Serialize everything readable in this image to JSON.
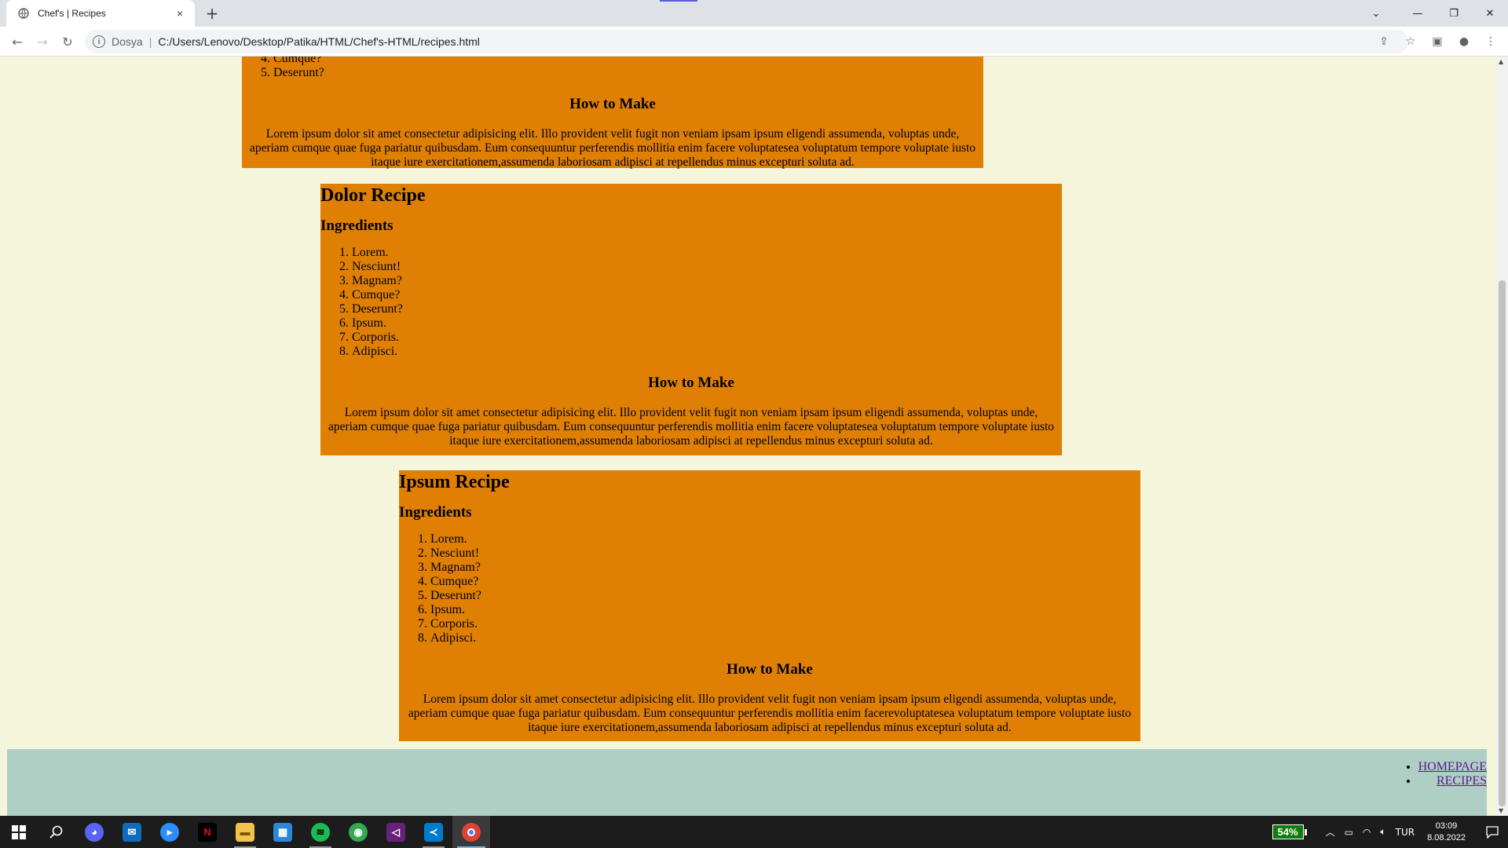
{
  "browser": {
    "tab_title": "Chef's | Recipes",
    "tab_close": "×",
    "new_tab": "+",
    "address_scheme": "Dosya",
    "address_url": "C:/Users/Lenovo/Desktop/Patika/HTML/Chef's-HTML/recipes.html"
  },
  "recipes": [
    {
      "title": "",
      "partial_items": [
        "Cumque?",
        "Deserunt?"
      ],
      "how_heading": "How to Make",
      "description": "Lorem ipsum dolor sit amet consectetur adipisicing elit. Illo provident velit fugit non veniam ipsam ipsum eligendi assumenda, voluptas unde, aperiam cumque quae fuga pariatur quibusdam. Eum consequuntur perferendis mollitia enim facere voluptatesea voluptatum tempore voluptate iusto itaque iure exercitationem,assumenda laboriosam adipisci at repellendus minus excepturi soluta ad."
    },
    {
      "title": "Dolor Recipe",
      "ingredients_heading": "Ingredients",
      "items": [
        "Lorem.",
        "Nesciunt!",
        "Magnam?",
        "Cumque?",
        "Deserunt?",
        "Ipsum.",
        "Corporis.",
        "Adipisci."
      ],
      "how_heading": "How to Make",
      "description": "Lorem ipsum dolor sit amet consectetur adipisicing elit. Illo provident velit fugit non veniam ipsam ipsum eligendi assumenda, voluptas unde, aperiam cumque quae fuga pariatur quibusdam. Eum consequuntur perferendis mollitia enim facere voluptatesea voluptatum tempore voluptate iusto itaque iure exercitationem,assumenda laboriosam adipisci at repellendus minus excepturi soluta ad."
    },
    {
      "title": "Ipsum Recipe",
      "ingredients_heading": "Ingredients",
      "items": [
        "Lorem.",
        "Nesciunt!",
        "Magnam?",
        "Cumque?",
        "Deserunt?",
        "Ipsum.",
        "Corporis.",
        "Adipisci."
      ],
      "how_heading": "How to Make",
      "description": "Lorem ipsum dolor sit amet consectetur adipisicing elit. Illo provident velit fugit non veniam ipsam ipsum eligendi assumenda, voluptas unde, aperiam cumque quae fuga pariatur quibusdam. Eum consequuntur perferendis mollitia enim facerevoluptatesea voluptatum tempore voluptate iusto itaque iure exercitationem,assumenda laboriosam adipisci at repellendus minus excepturi soluta ad."
    }
  ],
  "footer": {
    "links": [
      "HOMEPAGE",
      "RECIPES"
    ]
  },
  "taskbar": {
    "battery": "54%",
    "language": "TUR",
    "time": "03:09",
    "date": "8.08.2022"
  },
  "colors": {
    "page_bg": "#f5f5dc",
    "recipe_bg": "#df8005",
    "footer_bg": "#b0cfc4"
  }
}
